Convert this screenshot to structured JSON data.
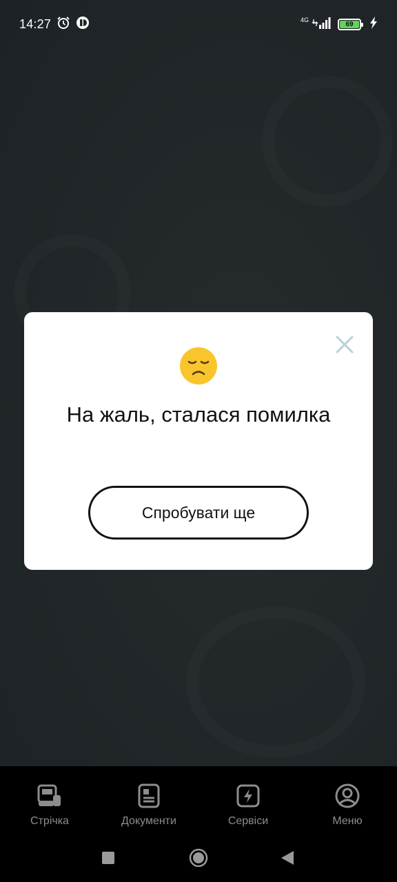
{
  "status_bar": {
    "time": "14:27",
    "network_type": "4G",
    "battery_level": "69",
    "icons": [
      "alarm-icon",
      "app-notification-icon",
      "signal-icon",
      "battery-icon",
      "charging-icon"
    ]
  },
  "dialog": {
    "emoji": "😞",
    "title": "На жаль, сталася помилка",
    "retry_label": "Спробувати ще",
    "close_icon": "close-icon"
  },
  "bottom_nav": {
    "items": [
      {
        "label": "Стрічка",
        "icon": "feed-icon"
      },
      {
        "label": "Документи",
        "icon": "documents-icon"
      },
      {
        "label": "Сервіси",
        "icon": "services-icon"
      },
      {
        "label": "Меню",
        "icon": "profile-icon"
      }
    ]
  },
  "system_nav": {
    "icons": [
      "recents-icon",
      "home-icon",
      "back-icon"
    ]
  },
  "colors": {
    "background": "#1e2326",
    "dialog": "#ffffff",
    "nav_background": "#000000",
    "nav_text": "#8d8d8d",
    "battery": "#5fd35a",
    "close_icon": "#b5d3e0"
  }
}
